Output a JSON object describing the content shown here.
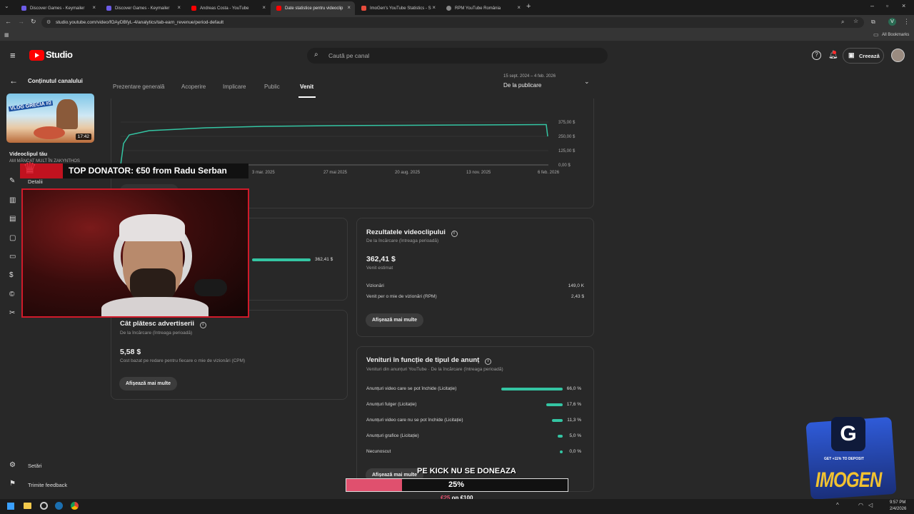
{
  "browser": {
    "tabs": [
      {
        "label": "Discover Games - Keymailer",
        "color": "#6c5ce7"
      },
      {
        "label": "Discover Games - Keymailer",
        "color": "#6c5ce7"
      },
      {
        "label": "Andreas Costa - YouTube",
        "color": "#ff0000"
      },
      {
        "label": "Date statistice pentru videoclip",
        "color": "#ff0000"
      },
      {
        "label": "ImoGen's YouTube Statistics - S",
        "color": "#e74c3c"
      },
      {
        "label": "RPM YouTube România",
        "color": "#888888"
      }
    ],
    "url": "studio.youtube.com/video/fOAyDBfyL-4/analytics/tab-earn_revenue/period-default",
    "all_bookmarks": "All Bookmarks"
  },
  "header": {
    "logo_text": "Studio",
    "search_placeholder": "Caută pe canal",
    "create_label": "Creează"
  },
  "sidebar": {
    "back_label": "Conținutul canalului",
    "thumb_title": "VLOG GRECIA #2",
    "duration": "17:42",
    "your_video": "Videoclipul tău",
    "video_title": "AM MÂNCAT MULT ÎN ZAKYNTHOS",
    "details": "Detalii",
    "settings": "Setări",
    "feedback": "Trimite feedback"
  },
  "tabs": [
    {
      "label": "Prezentare generală"
    },
    {
      "label": "Acoperire"
    },
    {
      "label": "Implicare"
    },
    {
      "label": "Public"
    },
    {
      "label": "Venit"
    }
  ],
  "period": {
    "range": "15 sept. 2024 – 4 feb. 2026",
    "label": "De la publicare"
  },
  "chart_data": {
    "type": "line",
    "x_ticks": [
      "3 mar. 2025",
      "27 mai 2025",
      "20 aug. 2025",
      "13 nov. 2025",
      "6 feb. 2026"
    ],
    "y_ticks": [
      "375,00 $",
      "250,00 $",
      "125,00 $",
      "0,00 $"
    ],
    "ylim": [
      0,
      375
    ]
  },
  "revenue_bar_value": "362,41 $",
  "video_results": {
    "title": "Rezultatele videoclipului",
    "subtitle": "De la încărcare (întreaga perioadă)",
    "value": "362,41 $",
    "value_label": "Venit estimat",
    "rows": [
      {
        "label": "Vizionări",
        "value": "149,0 K"
      },
      {
        "label": "Venit per o mie de vizionări (RPM)",
        "value": "2,43 $"
      }
    ],
    "button": "Afișează mai multe"
  },
  "advertisers": {
    "title": "Cât plătesc advertiserii",
    "subtitle": "De la încărcare (întreaga perioadă)",
    "value": "5,58 $",
    "value_label": "Cost bazat pe redare pentru fiecare o mie de vizionări (CPM)",
    "button": "Afișează mai multe"
  },
  "ad_types": {
    "title": "Venituri în funcție de tipul de anunț",
    "subtitle": "Venituri din anunțuri YouTube · De la încărcare (întreaga perioadă)",
    "rows": [
      {
        "label": "Anunțuri video care se pot închide (Licitație)",
        "value": "66,0 %",
        "pct": 66.0
      },
      {
        "label": "Anunțuri fulger (Licitație)",
        "value": "17,6 %",
        "pct": 17.6
      },
      {
        "label": "Anunțuri video care nu se pot închide (Licitație)",
        "value": "11,3 %",
        "pct": 11.3
      },
      {
        "label": "Anunțuri grafice (Licitație)",
        "value": "5,0 %",
        "pct": 5.0
      },
      {
        "label": "Necunoscut",
        "value": "0,0 %",
        "pct": 0.0
      }
    ],
    "button": "Afișează mai multe"
  },
  "overlay": {
    "donator": "TOP DONATOR: €50 from Radu Serban",
    "goal_title": "PE KICK NU SE DONEAZA",
    "goal_percent": "25%",
    "goal_fraction": 0.25,
    "goal_current": "€25",
    "goal_on": "on",
    "goal_target": "€100",
    "sponsor_promo": "GET +11% TO DEPOSIT",
    "sponsor_name": "IMOGEN"
  },
  "taskbar": {
    "time": "9:57 PM",
    "date": "2/4/2026"
  },
  "colors": {
    "accent": "#34c5a3",
    "youtube_red": "#ff0000",
    "goal_fill": "#e0506e"
  }
}
